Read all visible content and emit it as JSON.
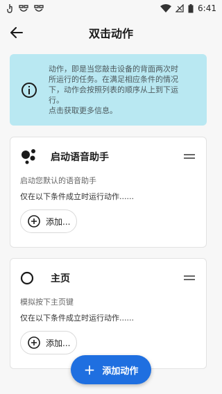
{
  "status_bar": {
    "time": "6:41",
    "left_icons": [
      "hand-icon",
      "notification-icon",
      "notification-icon"
    ]
  },
  "app_bar": {
    "title": "双击动作"
  },
  "info_banner": {
    "text_line1": "动作，即是当您敲击设备的背面两次时",
    "text_line2": "所运行的任务。在满足相应条件的情况",
    "text_line3": "下，动作会按照列表的顺序从上到下运",
    "text_line4": "行。",
    "text_line5": "点击获取更多信息。"
  },
  "actions": [
    {
      "title": "启动语音助手",
      "description": "启动您默认的语音助手",
      "condition": "仅在以下条件成立时运行动作......",
      "add_button": "添加..."
    },
    {
      "title": "主页",
      "description": "模拟按下主页键",
      "condition": "仅在以下条件成立时运行动作......",
      "add_button": "添加..."
    }
  ],
  "fab": {
    "label": "添加动作"
  },
  "colors": {
    "accent": "#1f6fe0",
    "banner_bg": "#b9e8f2",
    "background": "#f7f7f7"
  }
}
